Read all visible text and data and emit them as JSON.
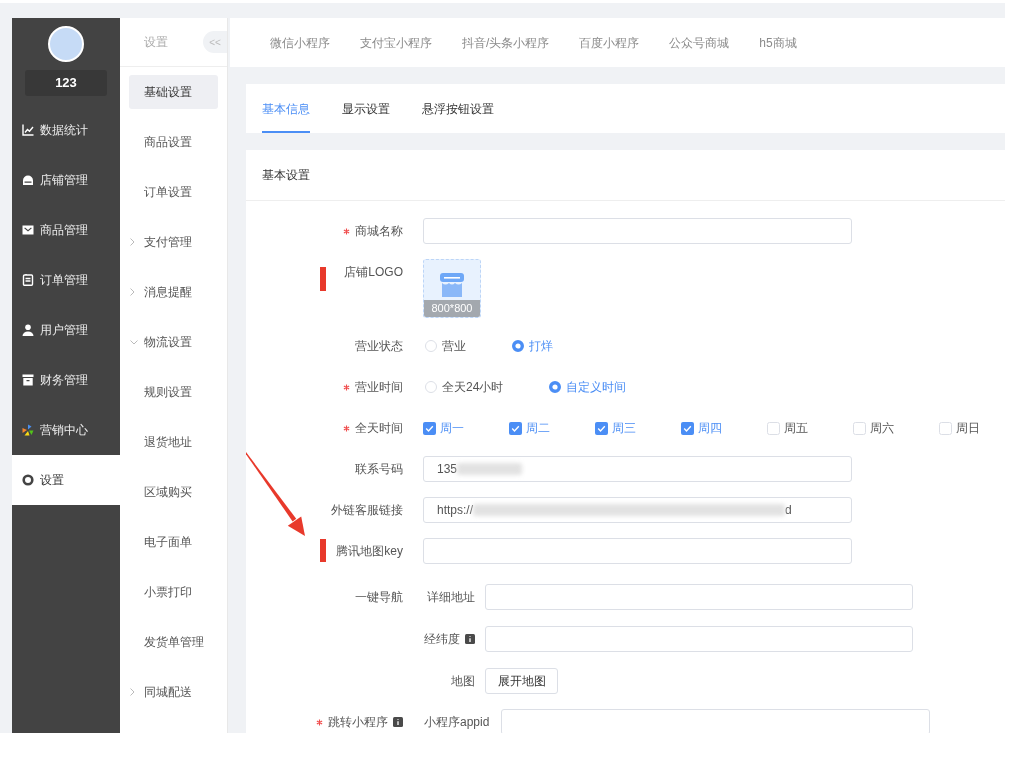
{
  "sidebar": {
    "user_name": "123",
    "items": [
      {
        "label": "数据统计",
        "selected": false
      },
      {
        "label": "店铺管理",
        "selected": false
      },
      {
        "label": "商品管理",
        "selected": false
      },
      {
        "label": "订单管理",
        "selected": false
      },
      {
        "label": "用户管理",
        "selected": false
      },
      {
        "label": "财务管理",
        "selected": false
      },
      {
        "label": "营销中心",
        "selected": false
      },
      {
        "label": "设置",
        "selected": true
      }
    ]
  },
  "subnav": {
    "title": "设置",
    "collapse_button": "<<",
    "items": [
      {
        "label": "基础设置",
        "kind": "page",
        "selected": true
      },
      {
        "label": "商品设置",
        "kind": "page",
        "selected": false
      },
      {
        "label": "订单设置",
        "kind": "page",
        "selected": false
      },
      {
        "label": "支付管理",
        "kind": "group",
        "expanded": false,
        "selected": false
      },
      {
        "label": "消息提醒",
        "kind": "group",
        "expanded": false,
        "selected": false
      },
      {
        "label": "物流设置",
        "kind": "group",
        "expanded": true,
        "selected": false
      },
      {
        "label": "规则设置",
        "kind": "page",
        "selected": false
      },
      {
        "label": "退货地址",
        "kind": "page",
        "selected": false
      },
      {
        "label": "区域购买",
        "kind": "page",
        "selected": false
      },
      {
        "label": "电子面单",
        "kind": "page",
        "selected": false
      },
      {
        "label": "小票打印",
        "kind": "page",
        "selected": false
      },
      {
        "label": "发货单管理",
        "kind": "page",
        "selected": false
      },
      {
        "label": "同城配送",
        "kind": "group",
        "expanded": false,
        "selected": false
      }
    ]
  },
  "platform_tabs": [
    {
      "label": "微信小程序",
      "selected": false
    },
    {
      "label": "支付宝小程序",
      "selected": false
    },
    {
      "label": "抖音/头条小程序",
      "selected": false
    },
    {
      "label": "百度小程序",
      "selected": false
    },
    {
      "label": "公众号商城",
      "selected": false
    },
    {
      "label": "h5商城",
      "selected": false
    }
  ],
  "section_tabs": [
    {
      "label": "基本信息",
      "selected": true
    },
    {
      "label": "显示设置",
      "selected": false
    },
    {
      "label": "悬浮按钮设置",
      "selected": false
    }
  ],
  "form": {
    "title": "基本设置",
    "pointer_arrow": true,
    "rows": [
      {
        "kind": "text_input",
        "label": "商城名称",
        "required": true,
        "info": false,
        "marked": false,
        "redacted": false
      },
      {
        "kind": "image_upload",
        "label": "店铺LOGO",
        "required": false,
        "info": false,
        "marked": true,
        "size_hint": "800*800"
      },
      {
        "kind": "radio",
        "label": "营业状态",
        "required": false,
        "info": false,
        "marked": false,
        "options": [
          {
            "label": "营业",
            "selected": false
          },
          {
            "label": "打烊",
            "selected": true
          }
        ]
      },
      {
        "kind": "radio",
        "label": "营业时间",
        "required": true,
        "info": false,
        "marked": false,
        "options": [
          {
            "label": "全天24小时",
            "selected": false
          },
          {
            "label": "自定义时间",
            "selected": true
          }
        ]
      },
      {
        "kind": "checkbox",
        "label": "全天时间",
        "required": true,
        "info": false,
        "marked": false,
        "options": [
          {
            "label": "周一",
            "checked": true
          },
          {
            "label": "周二",
            "checked": true
          },
          {
            "label": "周三",
            "checked": true
          },
          {
            "label": "周四",
            "checked": true
          },
          {
            "label": "周五",
            "checked": false
          },
          {
            "label": "周六",
            "checked": false
          },
          {
            "label": "周日",
            "checked": false
          }
        ]
      },
      {
        "kind": "text_input",
        "label": "联系号码",
        "required": false,
        "info": false,
        "marked": false,
        "value": "135",
        "redacted": true
      },
      {
        "kind": "text_input",
        "label": "外链客服链接",
        "required": false,
        "info": false,
        "marked": false,
        "value": "https://",
        "redacted": true,
        "value_tail": "d"
      },
      {
        "kind": "text_input",
        "label": "腾讯地图key",
        "required": false,
        "info": false,
        "marked": true,
        "redacted": false
      },
      {
        "kind": "group",
        "label": "一键导航",
        "required": false,
        "info": false,
        "marked": false,
        "fields": [
          {
            "kind": "text_input",
            "label": "详细地址",
            "info": false
          },
          {
            "kind": "text_input",
            "label": "经纬度",
            "info": true
          },
          {
            "kind": "button",
            "label": "地图",
            "info": false,
            "button": "展开地图"
          }
        ]
      },
      {
        "kind": "sub_input",
        "label": "跳转小程序",
        "required": true,
        "info": true,
        "marked": false,
        "sub_label": "小程序appid"
      }
    ]
  }
}
